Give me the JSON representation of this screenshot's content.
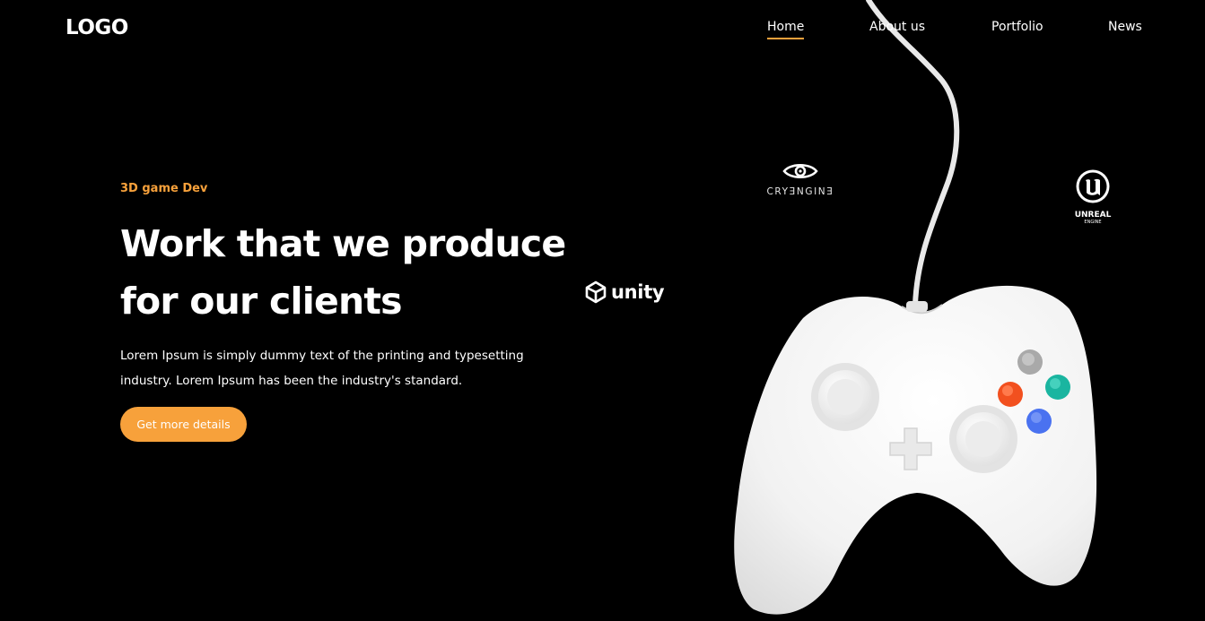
{
  "header": {
    "logo": "LOGO",
    "nav": [
      {
        "label": "Home",
        "active": true
      },
      {
        "label": "About us",
        "active": false
      },
      {
        "label": "Portfolio",
        "active": false
      },
      {
        "label": "News",
        "active": false
      }
    ]
  },
  "hero": {
    "eyebrow": "3D game Dev",
    "title_lines": [
      "Work that we produce",
      "for our clients"
    ],
    "description_lines": [
      "Lorem Ipsum is simply dummy text of the printing and typesetting",
      "industry. Lorem Ipsum has been the industry's standard."
    ],
    "cta_label": "Get more details"
  },
  "engines": {
    "unity": "unity",
    "cryengine": "CRYƎNGINƎ",
    "unreal": "UNREAL",
    "unreal_sub": "ENGINE"
  },
  "illustration": {
    "name": "white game controller",
    "button_colors": [
      "#a9a9a9",
      "#f2501f",
      "#1ab5a0",
      "#4a72f0"
    ]
  },
  "colors": {
    "background": "#000000",
    "accent": "#f7a13b",
    "text": "#ffffff"
  }
}
